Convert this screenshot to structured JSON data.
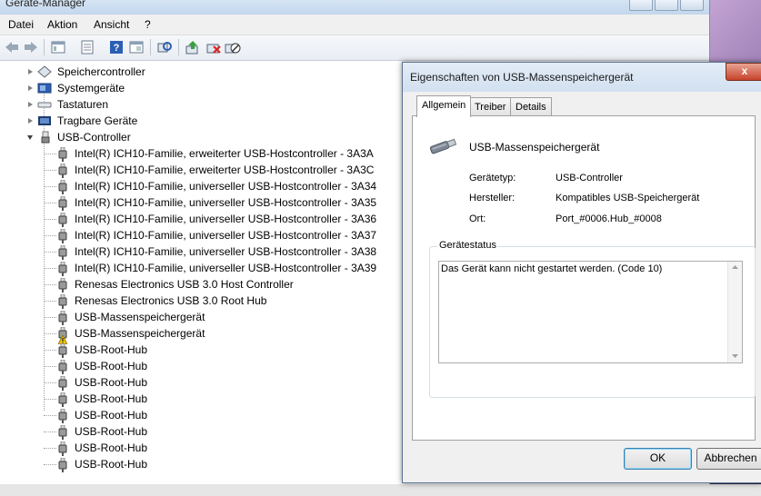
{
  "main_window": {
    "title": "Geräte-Manager",
    "menu": [
      "Datei",
      "Aktion",
      "Ansicht",
      "?"
    ]
  },
  "tree": {
    "collapsed_categories": [
      {
        "label": "Speichercontroller",
        "icon": "storage-controller-icon"
      },
      {
        "label": "Systemgeräte",
        "icon": "system-devices-icon"
      },
      {
        "label": "Tastaturen",
        "icon": "keyboard-icon"
      },
      {
        "label": "Tragbare Geräte",
        "icon": "portable-device-icon"
      }
    ],
    "expanded_category": {
      "label": "USB-Controller",
      "icon": "usb-icon"
    },
    "children": [
      {
        "label": "Intel(R) ICH10-Familie, erweiterter USB-Hostcontroller - 3A3A",
        "warning": false
      },
      {
        "label": "Intel(R) ICH10-Familie, erweiterter USB-Hostcontroller - 3A3C",
        "warning": false
      },
      {
        "label": "Intel(R) ICH10-Familie, universeller USB-Hostcontroller - 3A34",
        "warning": false
      },
      {
        "label": "Intel(R) ICH10-Familie, universeller USB-Hostcontroller - 3A35",
        "warning": false
      },
      {
        "label": "Intel(R) ICH10-Familie, universeller USB-Hostcontroller - 3A36",
        "warning": false
      },
      {
        "label": "Intel(R) ICH10-Familie, universeller USB-Hostcontroller - 3A37",
        "warning": false
      },
      {
        "label": "Intel(R) ICH10-Familie, universeller USB-Hostcontroller - 3A38",
        "warning": false
      },
      {
        "label": "Intel(R) ICH10-Familie, universeller USB-Hostcontroller - 3A39",
        "warning": false
      },
      {
        "label": "Renesas Electronics USB 3.0 Host Controller",
        "warning": false
      },
      {
        "label": "Renesas Electronics USB 3.0 Root Hub",
        "warning": false
      },
      {
        "label": "USB-Massenspeichergerät",
        "warning": false
      },
      {
        "label": "USB-Massenspeichergerät",
        "warning": true
      },
      {
        "label": "USB-Root-Hub",
        "warning": false
      },
      {
        "label": "USB-Root-Hub",
        "warning": false
      },
      {
        "label": "USB-Root-Hub",
        "warning": false
      },
      {
        "label": "USB-Root-Hub",
        "warning": false
      },
      {
        "label": "USB-Root-Hub",
        "warning": false
      },
      {
        "label": "USB-Root-Hub",
        "warning": false
      },
      {
        "label": "USB-Root-Hub",
        "warning": false
      },
      {
        "label": "USB-Root-Hub",
        "warning": false
      }
    ]
  },
  "dialog": {
    "title": "Eigenschaften von USB-Massenspeichergerät",
    "close_label": "x",
    "tabs": [
      "Allgemein",
      "Treiber",
      "Details"
    ],
    "active_tab": "Allgemein",
    "device_name": "USB-Massenspeichergerät",
    "props": {
      "type_label": "Gerätetyp:",
      "type_value": "USB-Controller",
      "maker_label": "Hersteller:",
      "maker_value": "Kompatibles USB-Speichergerät",
      "location_label": "Ort:",
      "location_value": "Port_#0006.Hub_#0008"
    },
    "status_legend": "Gerätestatus",
    "status_text": "Das Gerät kann nicht gestartet werden. (Code 10)",
    "ok_label": "OK",
    "cancel_label": "Abbrechen"
  },
  "colors": {
    "warning": "#f2c200",
    "accent": "#3c7fb1"
  }
}
